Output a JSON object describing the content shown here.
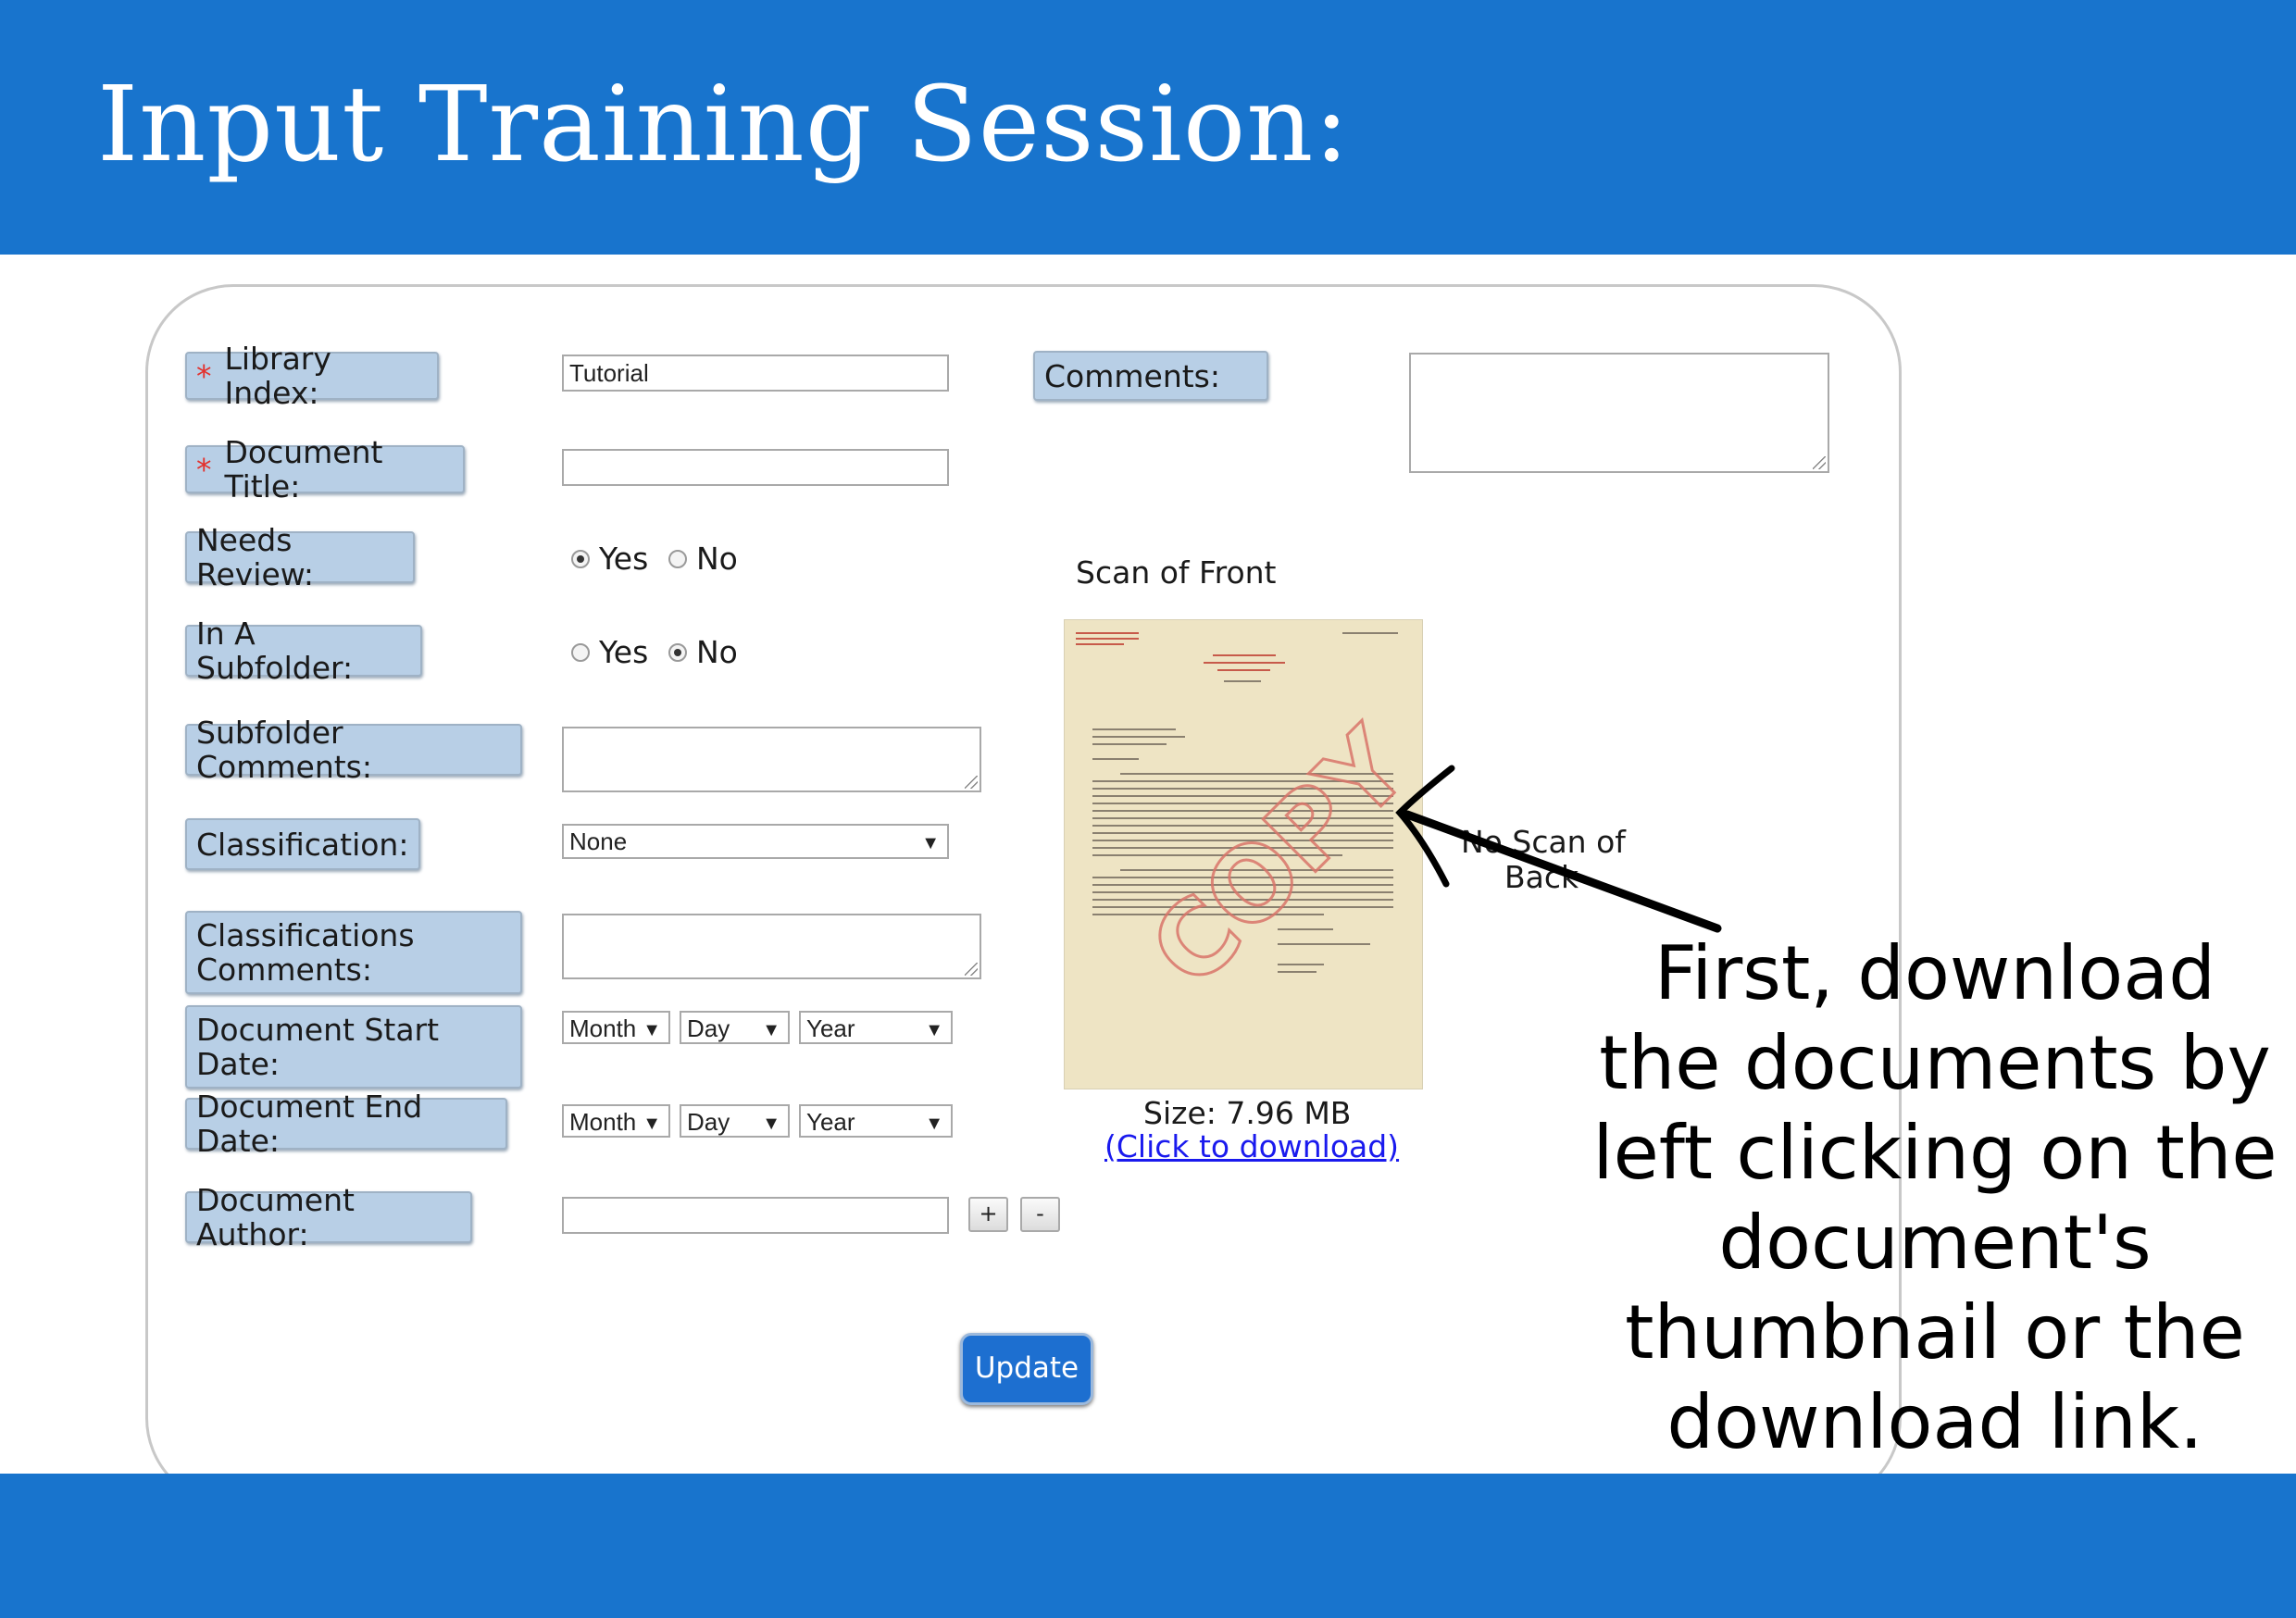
{
  "slide": {
    "title": "Input Training Session:"
  },
  "form": {
    "library_index": {
      "label": "Library Index:",
      "required": "*",
      "value": "Tutorial"
    },
    "document_title": {
      "label": "Document Title:",
      "required": "*",
      "value": ""
    },
    "needs_review": {
      "label": "Needs Review:",
      "options": [
        "Yes",
        "No"
      ],
      "selected": "Yes"
    },
    "in_subfolder": {
      "label": "In A Subfolder:",
      "options": [
        "Yes",
        "No"
      ],
      "selected": "No"
    },
    "subfolder_comments": {
      "label": "Subfolder Comments:",
      "value": ""
    },
    "classification": {
      "label": "Classification:",
      "selected": "None"
    },
    "classifications_comments": {
      "label_line1": "Classifications",
      "label_line2": "Comments:",
      "value": ""
    },
    "start_date": {
      "label_line1": "Document Start",
      "label_line2": "Date:",
      "month": "Month",
      "day": "Day",
      "year": "Year"
    },
    "end_date": {
      "label": "Document End Date:",
      "month": "Month",
      "day": "Day",
      "year": "Year"
    },
    "author": {
      "label": "Document Author:",
      "value": "",
      "add": "+",
      "remove": "-"
    },
    "comments": {
      "label": "Comments:",
      "value": ""
    },
    "update_button": "Update"
  },
  "scan": {
    "front_label": "Scan of Front",
    "back_line1": "No Scan of",
    "back_line2": "Back",
    "size_text": "Size: 7.96 MB",
    "download_link": "(Click to download)",
    "stamp_text": "COPY"
  },
  "callout": {
    "line1": "First, download",
    "line2": "the documents by",
    "line3": "left clicking on the",
    "line4": "document's",
    "line5": "thumbnail or the",
    "line6": "download link."
  },
  "colors": {
    "band": "#1874cd",
    "label_bg": "#b8cfe6",
    "required": "#e3312d",
    "button": "#1d6fd0",
    "link": "#1a1aee"
  }
}
